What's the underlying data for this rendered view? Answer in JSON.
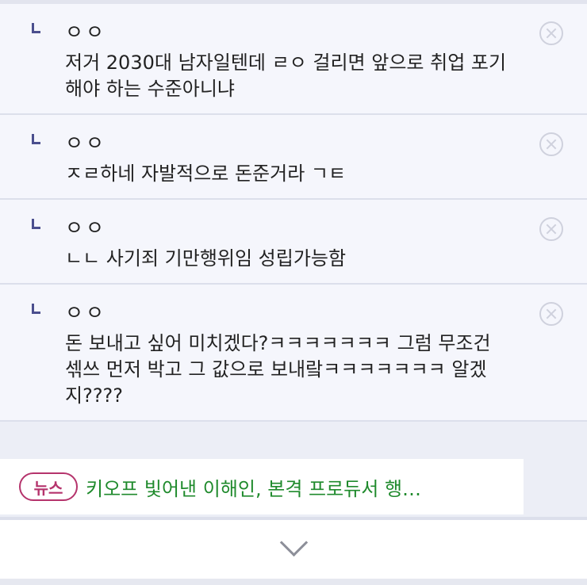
{
  "comments": [
    {
      "author": "ㅇㅇ",
      "text": "저거 2030대 남자일텐데 ㄹㅇ 걸리면 앞으로 취업 포기\n해야 하는 수준아니냐"
    },
    {
      "author": "ㅇㅇ",
      "text": "ㅈㄹ하네 자발적으로 돈준거라 ㄱㅌ"
    },
    {
      "author": "ㅇㅇ",
      "text": "ㄴㄴ 사기죄 기만행위임 성립가능함"
    },
    {
      "author": "ㅇㅇ",
      "text": "돈 보내고 싶어 미치겠다?ㅋㅋㅋㅋㅋㅋㅋ 그럼 무조건\n섺쓰 먼저 박고 그 값으로 보내랔ㅋㅋㅋㅋㅋㅋㅋ 알겠\n지????"
    }
  ],
  "news": {
    "badge": "뉴스",
    "headline": "키오프 빛어낸 이해인, 본격 프로듀서 행…"
  },
  "icons": {
    "reply": "reply-arrow-icon",
    "close": "close-circle-icon",
    "expand": "chevron-down-icon"
  },
  "colors": {
    "news_badge": "#b5336c",
    "news_headline": "#1f8a2c",
    "reply_mark": "#4b4f8e"
  }
}
